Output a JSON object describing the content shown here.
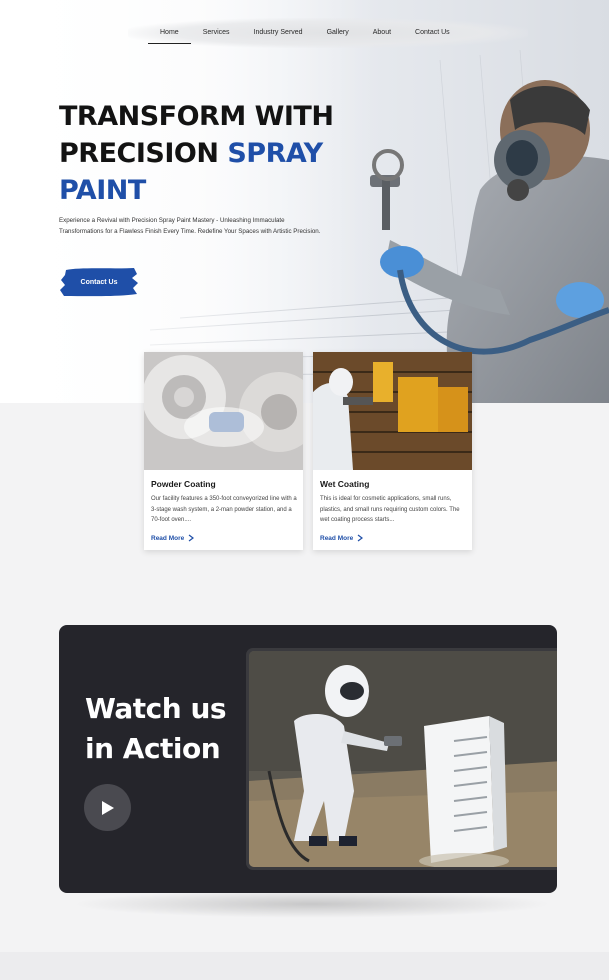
{
  "nav": {
    "items": [
      {
        "label": "Home",
        "active": true
      },
      {
        "label": "Services",
        "active": false
      },
      {
        "label": "Industry Served",
        "active": false
      },
      {
        "label": "Gallery",
        "active": false
      },
      {
        "label": "About",
        "active": false
      },
      {
        "label": "Contact Us",
        "active": false
      }
    ]
  },
  "hero": {
    "headline_line1": "TRANSFORM WITH",
    "headline_line2_dark": "PRECISION ",
    "headline_line2_blue": "SPRAY",
    "headline_line3_blue": "PAINT",
    "description": "Experience a Revival with Precision Spray Paint Mastery - Unleashing Immaculate Transformations for a Flawless Finish Every Time. Redefine Your Spaces with Artistic Precision.",
    "cta_label": "Contact Us"
  },
  "cards": [
    {
      "title": "Powder Coating",
      "text": "Our facility features a 350-foot conveyorized line with a 3-stage wash system, a 2-man powder station, and a 70-foot oven....",
      "link": "Read More"
    },
    {
      "title": "Wet Coating",
      "text": "This is ideal for cosmetic applications, small runs, plastics, and small runs requiring custom colors. The wet coating process starts...",
      "link": "Read More"
    }
  ],
  "video": {
    "title_line1": "Watch us",
    "title_line2": "in Action"
  },
  "colors": {
    "accent": "#1f4fa8",
    "dark_panel": "#25252b"
  }
}
